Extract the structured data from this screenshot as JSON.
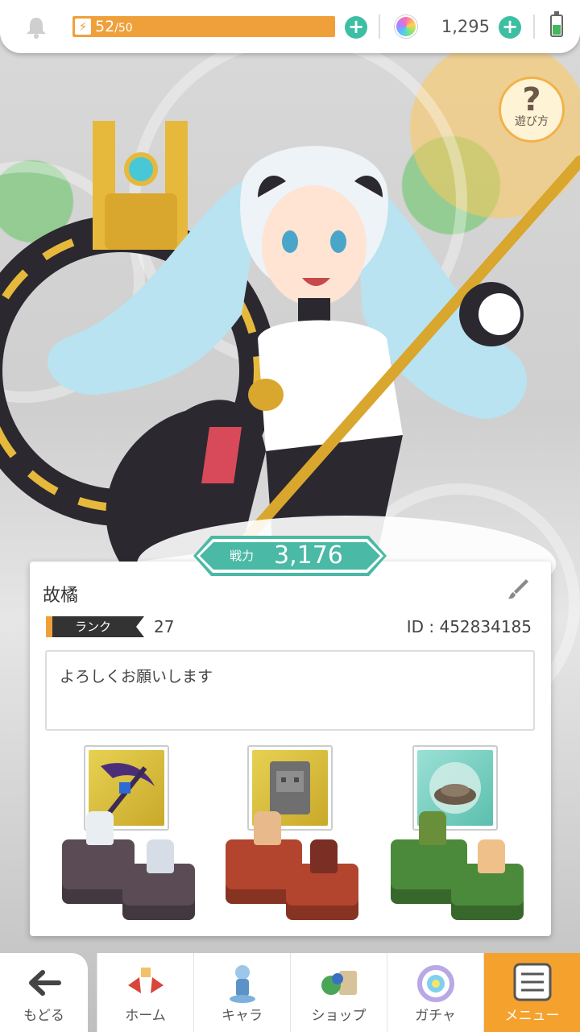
{
  "status_bar": {
    "stamina_current": "52",
    "stamina_max": "/50",
    "stamina_level": 1.0,
    "gem_count": "1,295"
  },
  "help": {
    "label": "遊び方",
    "icon": "question-icon"
  },
  "profile": {
    "power_label": "戦力",
    "power_value": "3,176",
    "name": "故橘",
    "rank_label": "ランク",
    "rank_value": "27",
    "player_id": "ID : 452834185",
    "comment": "よろしくお願いします"
  },
  "parties": [
    {
      "item_icon": "scythe-icon",
      "item_bg": "#d8c23a",
      "block_color": "#5a4b55"
    },
    {
      "item_icon": "stone-tablet-icon",
      "item_bg": "#d8c23a",
      "block_color": "#b3442e"
    },
    {
      "item_icon": "nest-icon",
      "item_bg": "#7fd2c7",
      "block_color": "#4b8a3a"
    }
  ],
  "nav": {
    "back": "もどる",
    "home": "ホーム",
    "chara": "キャラ",
    "shop": "ショップ",
    "gacha": "ガチャ",
    "menu": "メニュー"
  },
  "colors": {
    "accent_orange": "#f0a03a",
    "accent_teal": "#4ab9a6",
    "plus_green": "#3dbfa4"
  }
}
